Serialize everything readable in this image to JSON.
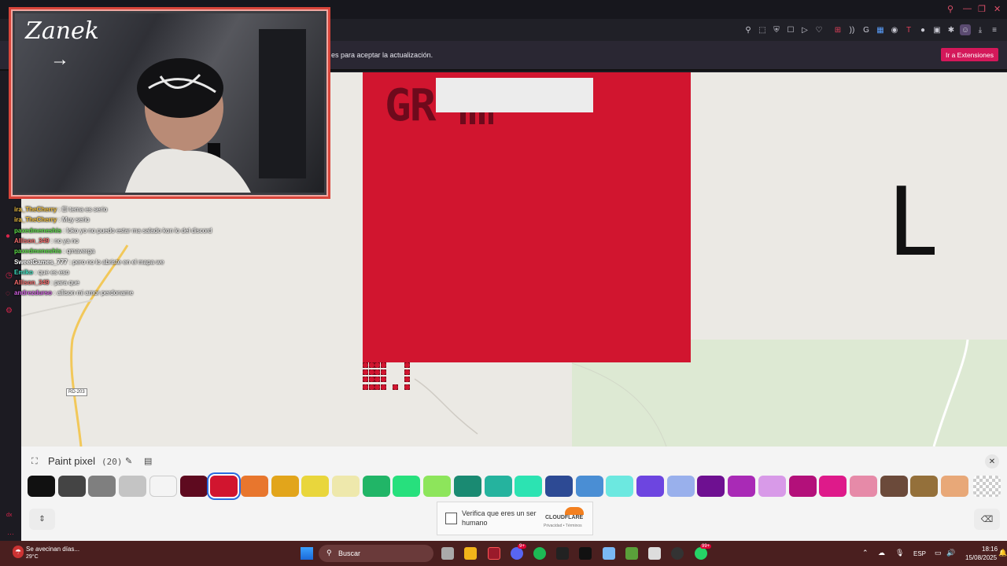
{
  "browser": {
    "notice_text": "es para aceptar la actualización.",
    "notice_button": "Ir a Extensiones"
  },
  "canvas": {
    "red_text": "GR",
    "big_letter": "L",
    "road_label": "RD-203"
  },
  "webcam": {
    "overlay_name": "Zanek",
    "overlay_arrow": "→"
  },
  "chat": {
    "messages": [
      {
        "user": "ira_TheCherry",
        "text": ": El tema es serio",
        "color": "#f0c040"
      },
      {
        "user": "ira_TheCherry",
        "text": ": Muy serio",
        "color": "#f0c040"
      },
      {
        "user": "paxedmeneshis",
        "text": ": loko yo no puedo estar ma salado kon lo del discord",
        "color": "#5ee04a"
      },
      {
        "user": "Allison_349",
        "text": ": no ya no",
        "color": "#f06a6a"
      },
      {
        "user": "paxedmeneshis",
        "text": ": qmaverga",
        "color": "#5ee04a"
      },
      {
        "user": "SweetGames_777",
        "text": ": pero no lo abriste en el mapa we",
        "color": "#ffffff"
      },
      {
        "user": "Emiko",
        "text": ": que es eso",
        "color": "#3de0c0"
      },
      {
        "user": "Allison_349",
        "text": ": para que",
        "color": "#f06a6a"
      },
      {
        "user": "andrezdurso",
        "text": ": allison mi amor perdoname",
        "color": "#d060e0"
      }
    ]
  },
  "paint": {
    "title": "Paint pixel",
    "count": "(20)",
    "colors": [
      "#111111",
      "#444444",
      "#7f7f7f",
      "#c4c4c4",
      "#f4f4f4",
      "#5e0a1f",
      "#d1152f",
      "#e8762d",
      "#e2a51b",
      "#e9d63c",
      "#eee8ac",
      "#21b567",
      "#27e07d",
      "#8de55b",
      "#1a8a72",
      "#25b39e",
      "#2ce3b2",
      "#2d4a94",
      "#4a8ed4",
      "#6ce8e0",
      "#6d45e0",
      "#99b0ec",
      "#6e1091",
      "#a92ab6",
      "#d89ae8",
      "#b3107a",
      "#de1a8a",
      "#e68aa8",
      "#6b4a3a",
      "#94703a",
      "#e8a878"
    ],
    "selected_index": 6
  },
  "captcha": {
    "label": "Verifica que eres un ser humano",
    "brand": "CLOUDFLARE",
    "links": "Privacidad • Términos"
  },
  "taskbar": {
    "weather_text": "Se avecinan días...",
    "weather_temp": "29°C",
    "search_placeholder": "Buscar",
    "lang": "ESP",
    "time": "18:16",
    "date": "15/08/2025",
    "badge_discord": "9+",
    "badge_whatsapp": "99+"
  },
  "rail": {
    "bottom_label": "dx"
  }
}
